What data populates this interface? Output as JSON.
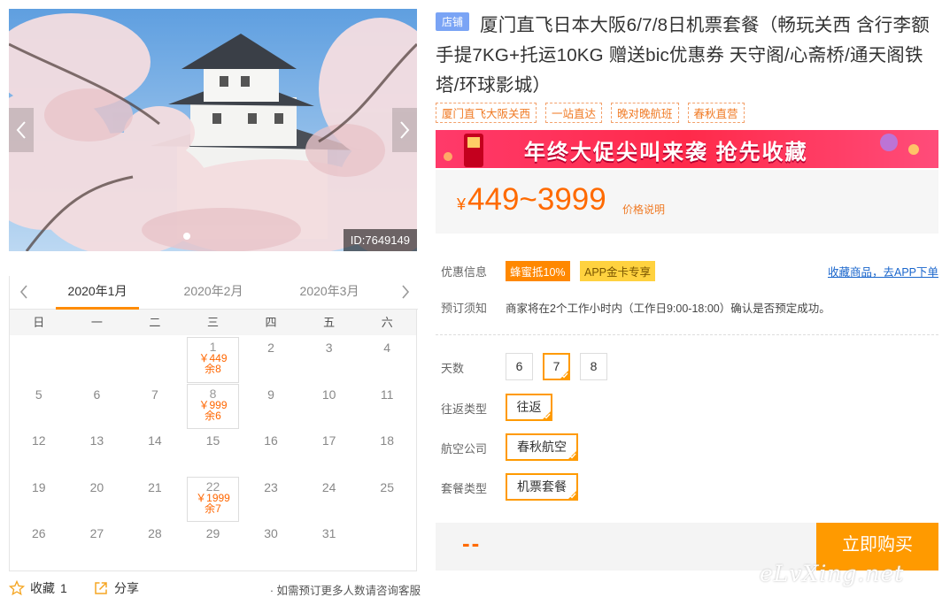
{
  "gallery": {
    "image_id": "ID:7649149",
    "dots": 2,
    "active_dot": 1
  },
  "calendar": {
    "months": [
      "2020年1月",
      "2020年2月",
      "2020年3月"
    ],
    "active_month": 0,
    "weekdays": [
      "日",
      "一",
      "二",
      "三",
      "四",
      "五",
      "六"
    ],
    "days": [
      {
        "d": ""
      },
      {
        "d": ""
      },
      {
        "d": ""
      },
      {
        "d": "1",
        "price": "￥449",
        "remain": "余8"
      },
      {
        "d": "2"
      },
      {
        "d": "3"
      },
      {
        "d": "4"
      },
      {
        "d": "5"
      },
      {
        "d": "6"
      },
      {
        "d": "7"
      },
      {
        "d": "8",
        "price": "￥999",
        "remain": "余6"
      },
      {
        "d": "9"
      },
      {
        "d": "10"
      },
      {
        "d": "11"
      },
      {
        "d": "12"
      },
      {
        "d": "13"
      },
      {
        "d": "14"
      },
      {
        "d": "15"
      },
      {
        "d": "16"
      },
      {
        "d": "17"
      },
      {
        "d": "18"
      },
      {
        "d": "19"
      },
      {
        "d": "20"
      },
      {
        "d": "21"
      },
      {
        "d": "22",
        "price": "￥1999",
        "remain": "余7"
      },
      {
        "d": "23"
      },
      {
        "d": "24"
      },
      {
        "d": "25"
      },
      {
        "d": "26"
      },
      {
        "d": "27"
      },
      {
        "d": "28"
      },
      {
        "d": "29"
      },
      {
        "d": "30"
      },
      {
        "d": "31"
      }
    ]
  },
  "actions": {
    "favorite_label": "收藏",
    "favorite_count": "1",
    "share_label": "分享",
    "note": "· 如需预订更多人数请咨询客服"
  },
  "product": {
    "shop_badge": "店铺",
    "title": "厦门直飞日本大阪6/7/8日机票套餐（畅玩关西 含行李额手提7KG+托运10KG 赠送bic优惠券 天守阁/心斋桥/通天阁铁塔/环球影城）",
    "tags": [
      "厦门直飞大阪关西",
      "一站直达",
      "晚对晚航班",
      "春秋直营"
    ],
    "banner_text": "年终大促尖叫来袭  抢先收藏",
    "currency": "¥",
    "price_range": "449~3999",
    "price_note": "价格说明"
  },
  "info": {
    "discount_label": "优惠信息",
    "promo1": "蜂蜜抵10%",
    "promo2": "APP金卡专享",
    "fav_link": "收藏商品，去APP下单",
    "notice_label": "预订须知",
    "notice_text": "商家将在2个工作小时内（工作日9:00-18:00）确认是否预定成功。"
  },
  "options": {
    "days_label": "天数",
    "days": [
      "6",
      "7",
      "8"
    ],
    "days_selected": "7",
    "trip_label": "往返类型",
    "trip_value": "往返",
    "airline_label": "航空公司",
    "airline_value": "春秋航空",
    "package_label": "套餐类型",
    "package_value": "机票套餐"
  },
  "buy": {
    "total": "--",
    "button": "立即购买"
  },
  "watermark": "eLvXing.net",
  "colors": {
    "accent": "#ff9a00",
    "price": "#ff6a00",
    "link": "#1a66cc",
    "shop_badge": "#7aa4f5"
  }
}
